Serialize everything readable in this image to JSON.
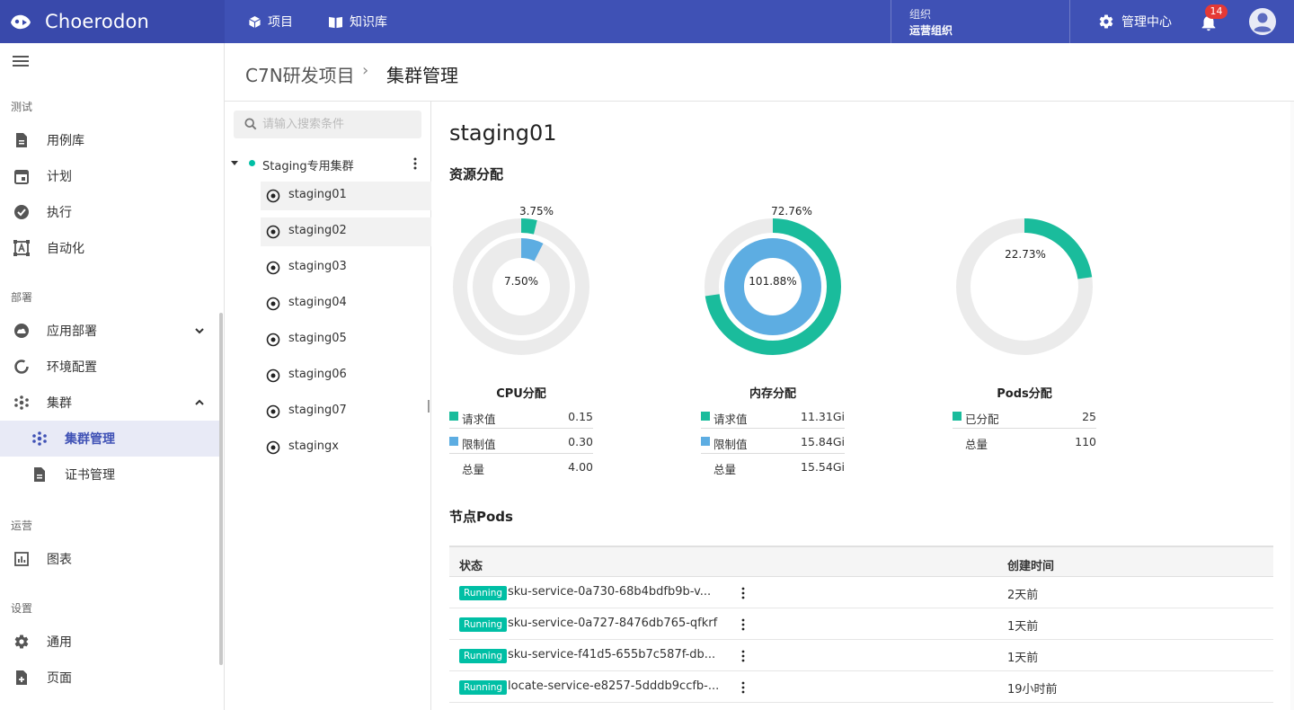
{
  "header": {
    "logo_text": "Choerodon",
    "nav": [
      {
        "label": "项目",
        "icon": "cube-icon"
      },
      {
        "label": "知识库",
        "icon": "book-icon"
      }
    ],
    "org_label": "组织",
    "org_value": "运营组织",
    "management_label": "管理中心",
    "notification_count": "14"
  },
  "sidebar": {
    "sections": [
      {
        "title": "测试",
        "items": [
          {
            "label": "用例库",
            "icon": "document-icon"
          },
          {
            "label": "计划",
            "icon": "calendar-icon"
          },
          {
            "label": "执行",
            "icon": "check-circle-icon"
          },
          {
            "label": "自动化",
            "icon": "automation-icon"
          }
        ]
      },
      {
        "title": "部署",
        "items": [
          {
            "label": "应用部署",
            "icon": "cloud-icon"
          },
          {
            "label": "环境配置",
            "icon": "ring-icon"
          },
          {
            "label": "集群",
            "icon": "cluster-icon"
          },
          {
            "label": "集群管理",
            "icon": "cluster-icon",
            "active": true
          },
          {
            "label": "证书管理",
            "icon": "document-icon"
          }
        ]
      },
      {
        "title": "运营",
        "items": [
          {
            "label": "图表",
            "icon": "bar-chart-icon"
          }
        ]
      },
      {
        "title": "设置",
        "items": [
          {
            "label": "通用",
            "icon": "gear-icon"
          },
          {
            "label": "页面",
            "icon": "page-add-icon"
          }
        ]
      }
    ]
  },
  "breadcrumb": {
    "project": "C7N研发项目",
    "separator": "›",
    "current": "集群管理"
  },
  "tree": {
    "search_placeholder": "请输入搜索条件",
    "group_label": "Staging专用集群",
    "nodes": [
      "staging01",
      "staging02",
      "staging03",
      "staging04",
      "staging05",
      "staging06",
      "staging07",
      "stagingx"
    ]
  },
  "main": {
    "cluster_title": "staging01",
    "resource_title": "资源分配",
    "pods_title": "节点Pods",
    "colors": {
      "request": "#1abc9c",
      "limit": "#5dade2",
      "track": "#ebebeb"
    },
    "charts": [
      {
        "title": "CPU分配",
        "outer_pct_label": "3.75%",
        "inner_pct_label": "7.50%",
        "outer_fraction": 0.0375,
        "inner_fraction": 0.075,
        "legend": [
          {
            "label": "请求值",
            "value": "0.15",
            "swatch": "request"
          },
          {
            "label": "限制值",
            "value": "0.30",
            "swatch": "limit"
          },
          {
            "label": "总量",
            "value": "4.00",
            "swatch": ""
          }
        ]
      },
      {
        "title": "内存分配",
        "outer_pct_label": "72.76%",
        "inner_pct_label": "101.88%",
        "outer_fraction": 0.7276,
        "inner_fraction": 1.0,
        "legend": [
          {
            "label": "请求值",
            "value": "11.31Gi",
            "swatch": "request"
          },
          {
            "label": "限制值",
            "value": "15.84Gi",
            "swatch": "limit"
          },
          {
            "label": "总量",
            "value": "15.54Gi",
            "swatch": ""
          }
        ]
      },
      {
        "title": "Pods分配",
        "outer_pct_label": "22.73%",
        "inner_pct_label": "",
        "outer_fraction": 0.2273,
        "inner_fraction": 0,
        "legend": [
          {
            "label": "已分配",
            "value": "25",
            "swatch": "request"
          },
          {
            "label": "总量",
            "value": "110",
            "swatch": ""
          }
        ]
      }
    ],
    "table": {
      "col_status": "状态",
      "col_created": "创建时间",
      "rows": [
        {
          "status": "Running",
          "name": "sku-service-0a730-68b4bdfb9b-v...",
          "created": "2天前"
        },
        {
          "status": "Running",
          "name": "sku-service-0a727-8476db765-qfkrf",
          "created": "1天前"
        },
        {
          "status": "Running",
          "name": "sku-service-f41d5-655b7c587f-db...",
          "created": "1天前"
        },
        {
          "status": "Running",
          "name": "locate-service-e8257-5dddb9ccfb-...",
          "created": "19小时前"
        }
      ]
    }
  }
}
